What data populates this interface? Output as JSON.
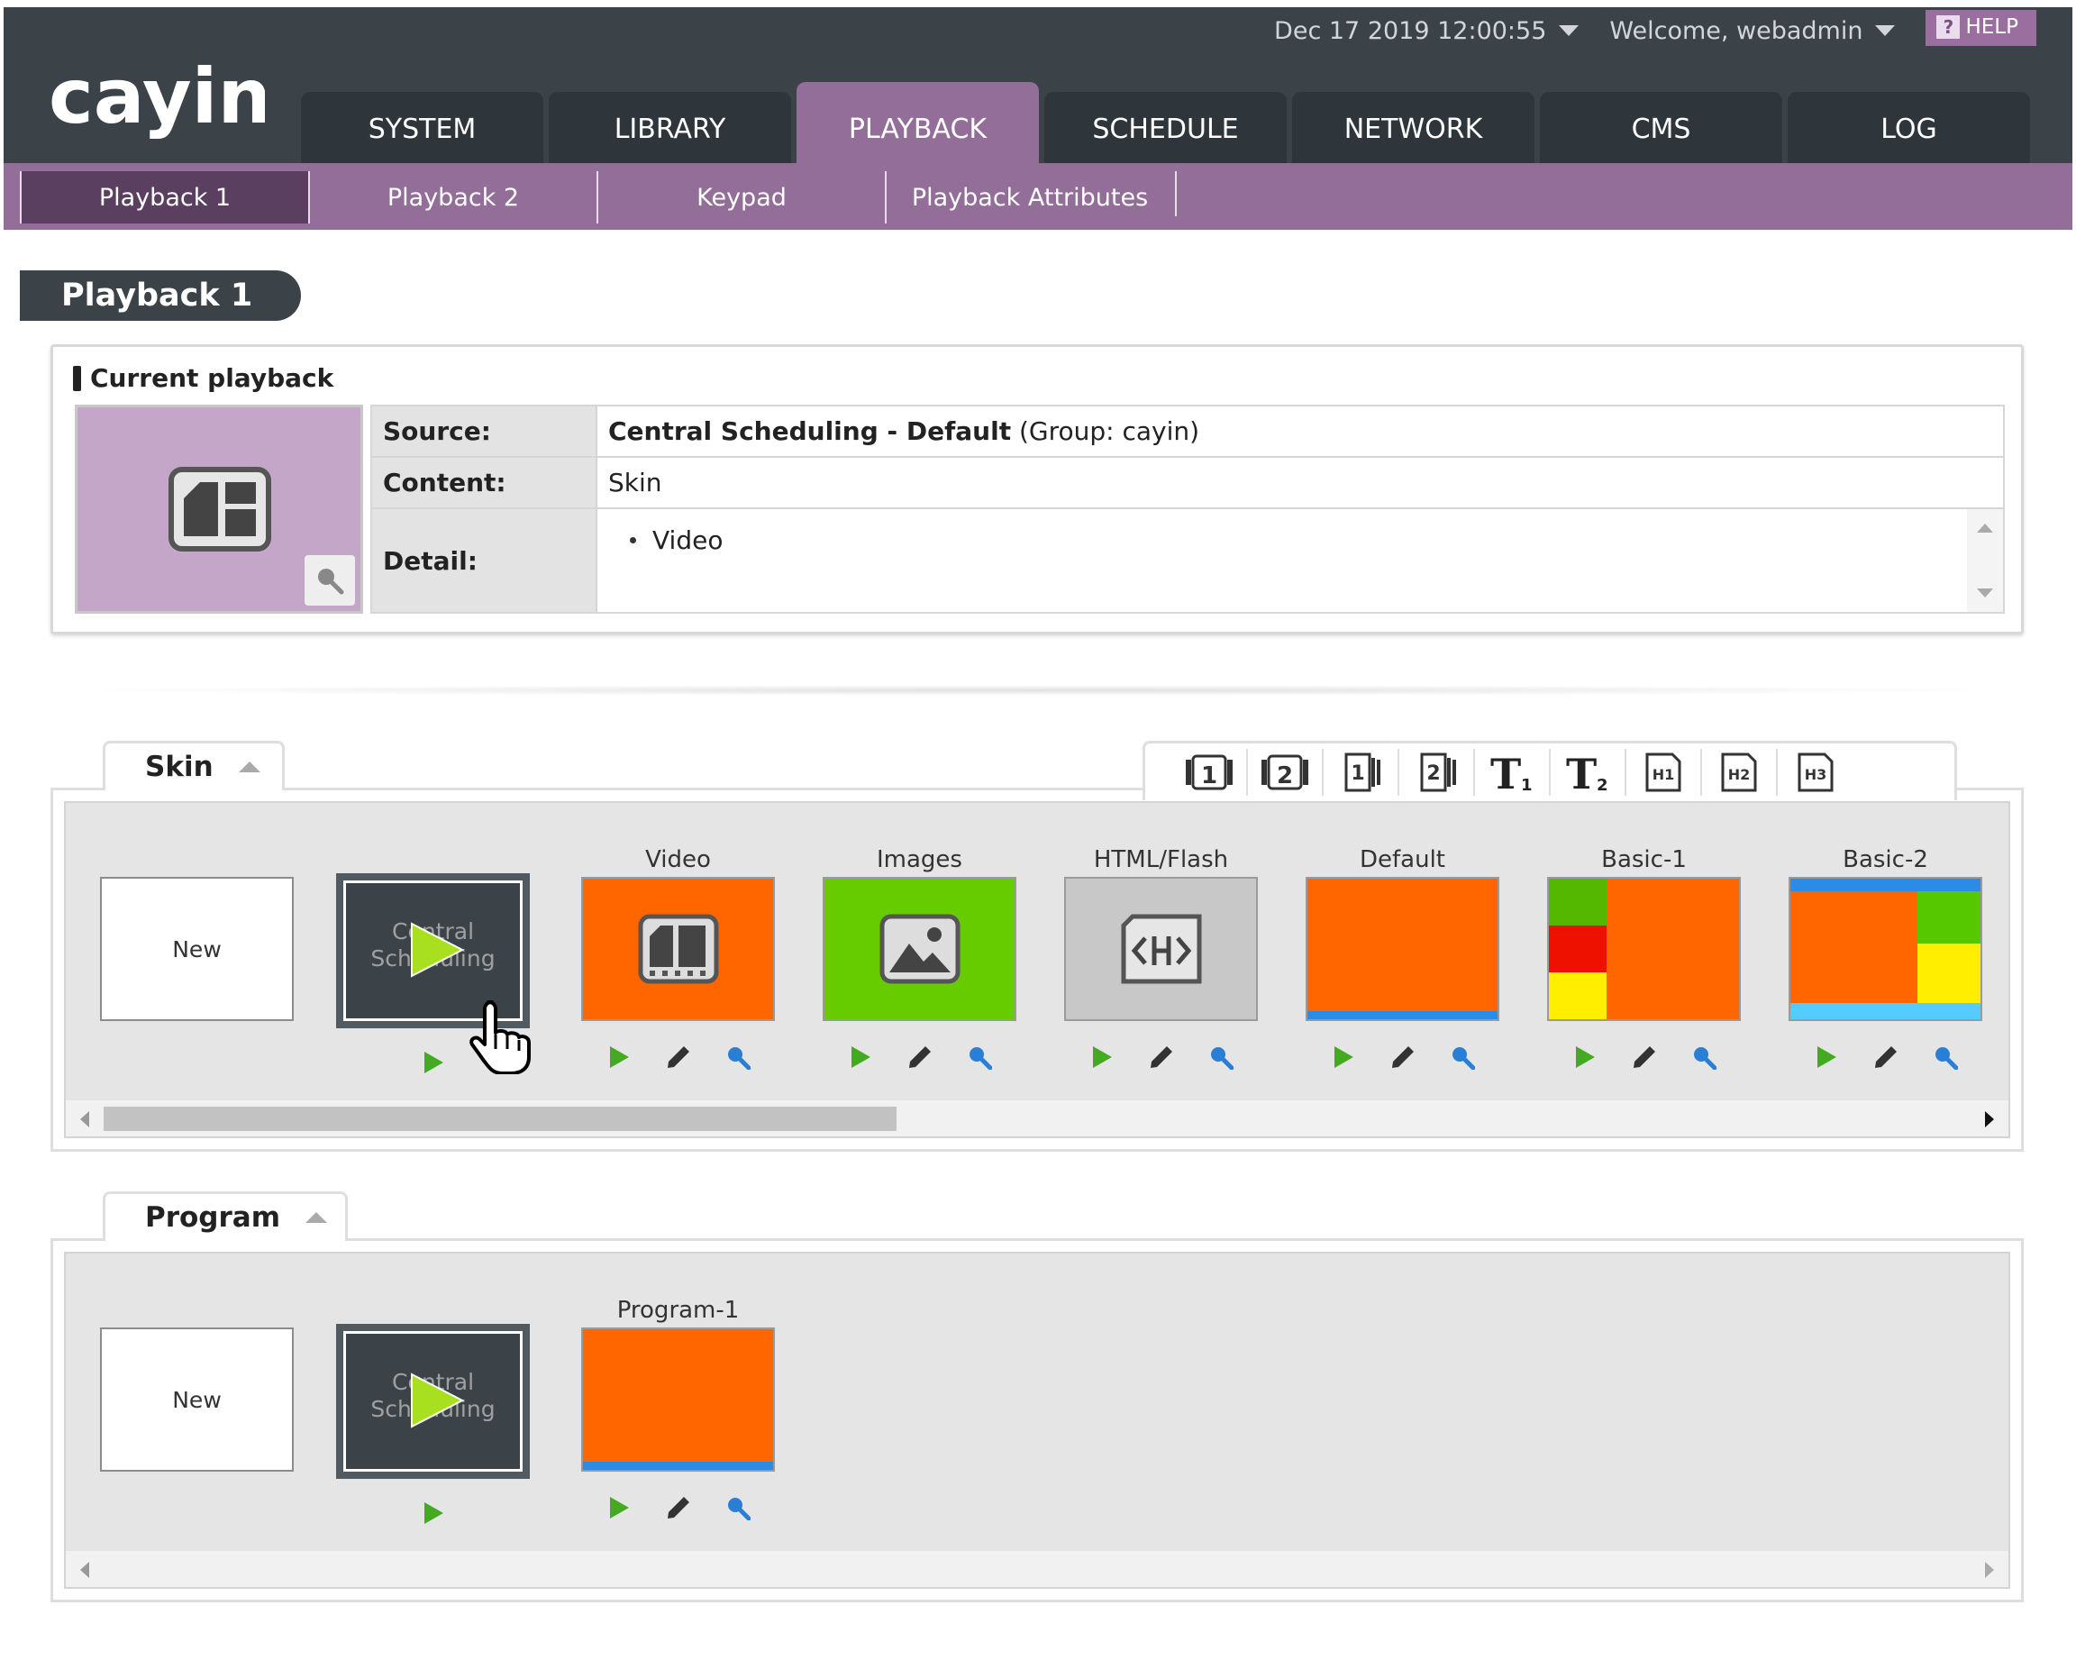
{
  "header": {
    "logo_text": "cayin",
    "datetime": "Dec 17 2019 12:00:55",
    "welcome": "Welcome, webadmin",
    "help_label": "HELP",
    "help_icon": "?",
    "main_tabs": [
      {
        "label": "SYSTEM",
        "active": false
      },
      {
        "label": "LIBRARY",
        "active": false
      },
      {
        "label": "PLAYBACK",
        "active": true
      },
      {
        "label": "SCHEDULE",
        "active": false
      },
      {
        "label": "NETWORK",
        "active": false
      },
      {
        "label": "CMS",
        "active": false
      },
      {
        "label": "LOG",
        "active": false
      }
    ],
    "sub_tabs": [
      {
        "label": "Playback 1",
        "active": true
      },
      {
        "label": "Playback 2",
        "active": false
      },
      {
        "label": "Keypad",
        "active": false
      },
      {
        "label": "Playback Attributes",
        "active": false
      }
    ]
  },
  "page_title": "Playback 1",
  "current_playback": {
    "title": "Current playback",
    "source_label": "Source:",
    "source_value": "Central Scheduling - Default",
    "source_group": "(Group: cayin)",
    "content_label": "Content:",
    "content_value": "Skin",
    "detail_label": "Detail:",
    "detail_items": [
      "Video"
    ]
  },
  "skin_section": {
    "title": "Skin",
    "tools": [
      "video-1-icon",
      "video-2-icon",
      "image-1-icon",
      "image-2-icon",
      "text-1-icon",
      "text-2-icon",
      "html-1-icon",
      "html-2-icon",
      "html-3-icon"
    ],
    "tool_text": {
      "t1": "T",
      "t1_sub": "1",
      "t2": "T",
      "t2_sub": "2",
      "h1": "H1",
      "h2": "H2",
      "h3": "H3",
      "v1": "1",
      "v2": "2",
      "i1": "1",
      "i2": "2"
    },
    "new_label": "New",
    "central_label": "Central Scheduling",
    "cards": [
      {
        "label": "Video",
        "color": "#ff6600"
      },
      {
        "label": "Images",
        "color": "#66cc00"
      },
      {
        "label": "HTML/Flash",
        "color": "#c8c8c8"
      },
      {
        "label": "Default",
        "color": "#ff6600"
      },
      {
        "label": "Basic-1",
        "color": "#ff6600"
      },
      {
        "label": "Basic-2",
        "color": "#ff6600"
      }
    ]
  },
  "program_section": {
    "title": "Program",
    "new_label": "New",
    "central_label": "Central Scheduling",
    "cards": [
      {
        "label": "Program-1",
        "color": "#ff6600"
      }
    ]
  },
  "colors": {
    "header_bg": "#3b4349",
    "accent_purple": "#926e99",
    "active_subtab": "#5b3f60",
    "play_green": "#44aa22",
    "zoom_blue": "#2a7fd4"
  }
}
